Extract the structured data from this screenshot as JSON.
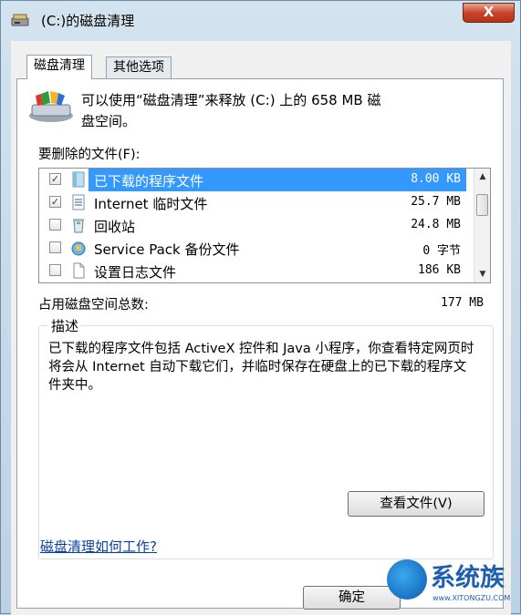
{
  "window": {
    "title": "(C:)的磁盘清理",
    "close_label": "X"
  },
  "tabs": [
    {
      "label": "磁盘清理",
      "active": true
    },
    {
      "label": "其他选项",
      "active": false
    }
  ],
  "intro": {
    "line1": "可以使用“磁盘清理”来释放  (C:) 上的 658 MB 磁",
    "line2": "盘空间。"
  },
  "files_label": "要删除的文件(F):",
  "files": [
    {
      "name": "已下载的程序文件",
      "size": "8.00 KB",
      "checked": true,
      "selected": true,
      "icon": "folder-icon"
    },
    {
      "name": "Internet 临时文件",
      "size": "25.7 MB",
      "checked": true,
      "selected": false,
      "icon": "document-icon"
    },
    {
      "name": "回收站",
      "size": "24.8 MB",
      "checked": false,
      "selected": false,
      "icon": "recycle-bin-icon"
    },
    {
      "name": "Service Pack 备份文件",
      "size": "0 字节",
      "checked": false,
      "selected": false,
      "icon": "installer-icon"
    },
    {
      "name": "设置日志文件",
      "size": "186 KB",
      "checked": false,
      "selected": false,
      "icon": "file-icon"
    }
  ],
  "total": {
    "label": "占用磁盘空间总数:",
    "value": "177 MB"
  },
  "description": {
    "title": "描述",
    "text": "已下载的程序文件包括 ActiveX 控件和 Java 小程序，你查看特定网页时将会从 Internet 自动下载它们，并临时保存在硬盘上的已下载的程序文件夹中。"
  },
  "view_files_button": "查看文件(V)",
  "help_link": "磁盘清理如何工作?",
  "ok_button": "确定",
  "watermark": {
    "text": "系统族",
    "sub": "www.XITONGZU.COM"
  },
  "colors": {
    "selection": "#3399ff",
    "link": "#0a3fa8",
    "close_button": "#c7442a"
  }
}
